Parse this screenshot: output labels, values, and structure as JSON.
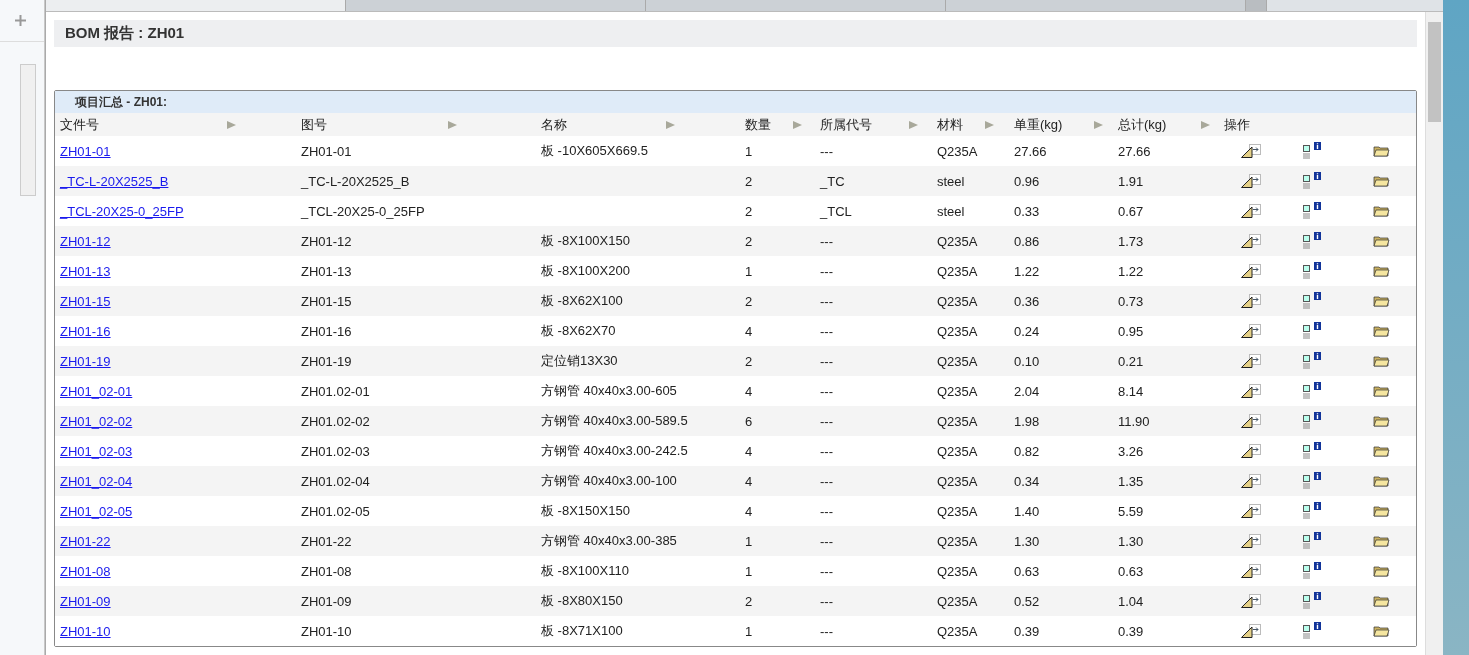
{
  "title": "BOM 报告 : ZH01",
  "section": "项目汇总 - ZH01:",
  "columns": [
    "文件号",
    "图号",
    "名称",
    "数量",
    "所属代号",
    "材料",
    "单重(kg)",
    "总计(kg)",
    "操作"
  ],
  "rows": [
    {
      "file": "ZH01-01",
      "drawing": "ZH01-01",
      "name": "板 -10X605X669.5",
      "qty": "1",
      "code": "---",
      "material": "Q235A",
      "unit": "27.66",
      "total": "27.66"
    },
    {
      "file": "_TC-L-20X2525_B",
      "drawing": "_TC-L-20X2525_B",
      "name": "",
      "qty": "2",
      "code": "_TC",
      "material": "steel",
      "unit": "0.96",
      "total": "1.91"
    },
    {
      "file": "_TCL-20X25-0_25FP",
      "drawing": "_TCL-20X25-0_25FP",
      "name": "",
      "qty": "2",
      "code": "_TCL",
      "material": "steel",
      "unit": "0.33",
      "total": "0.67"
    },
    {
      "file": "ZH01-12",
      "drawing": "ZH01-12",
      "name": "板 -8X100X150",
      "qty": "2",
      "code": "---",
      "material": "Q235A",
      "unit": "0.86",
      "total": "1.73"
    },
    {
      "file": "ZH01-13",
      "drawing": "ZH01-13",
      "name": "板 -8X100X200",
      "qty": "1",
      "code": "---",
      "material": "Q235A",
      "unit": "1.22",
      "total": "1.22"
    },
    {
      "file": "ZH01-15",
      "drawing": "ZH01-15",
      "name": "板 -8X62X100",
      "qty": "2",
      "code": "---",
      "material": "Q235A",
      "unit": "0.36",
      "total": "0.73"
    },
    {
      "file": "ZH01-16",
      "drawing": "ZH01-16",
      "name": "板 -8X62X70",
      "qty": "4",
      "code": "---",
      "material": "Q235A",
      "unit": "0.24",
      "total": "0.95"
    },
    {
      "file": "ZH01-19",
      "drawing": "ZH01-19",
      "name": "定位销13X30",
      "qty": "2",
      "code": "---",
      "material": "Q235A",
      "unit": "0.10",
      "total": "0.21"
    },
    {
      "file": "ZH01_02-01",
      "drawing": "ZH01.02-01",
      "name": "方钢管 40x40x3.00-605",
      "qty": "4",
      "code": "---",
      "material": "Q235A",
      "unit": "2.04",
      "total": "8.14"
    },
    {
      "file": "ZH01_02-02",
      "drawing": "ZH01.02-02",
      "name": "方钢管 40x40x3.00-589.5",
      "qty": "6",
      "code": "---",
      "material": "Q235A",
      "unit": "1.98",
      "total": "11.90"
    },
    {
      "file": "ZH01_02-03",
      "drawing": "ZH01.02-03",
      "name": "方钢管 40x40x3.00-242.5",
      "qty": "4",
      "code": "---",
      "material": "Q235A",
      "unit": "0.82",
      "total": "3.26"
    },
    {
      "file": "ZH01_02-04",
      "drawing": "ZH01.02-04",
      "name": "方钢管 40x40x3.00-100",
      "qty": "4",
      "code": "---",
      "material": "Q235A",
      "unit": "0.34",
      "total": "1.35"
    },
    {
      "file": "ZH01_02-05",
      "drawing": "ZH01.02-05",
      "name": "板 -8X150X150",
      "qty": "4",
      "code": "---",
      "material": "Q235A",
      "unit": "1.40",
      "total": "5.59"
    },
    {
      "file": "ZH01-22",
      "drawing": "ZH01-22",
      "name": "方钢管 40x40x3.00-385",
      "qty": "1",
      "code": "---",
      "material": "Q235A",
      "unit": "1.30",
      "total": "1.30"
    },
    {
      "file": "ZH01-08",
      "drawing": "ZH01-08",
      "name": "板 -8X100X110",
      "qty": "1",
      "code": "---",
      "material": "Q235A",
      "unit": "0.63",
      "total": "0.63"
    },
    {
      "file": "ZH01-09",
      "drawing": "ZH01-09",
      "name": "板 -8X80X150",
      "qty": "2",
      "code": "---",
      "material": "Q235A",
      "unit": "0.52",
      "total": "1.04"
    },
    {
      "file": "ZH01-10",
      "drawing": "ZH01-10",
      "name": "板 -8X71X100",
      "qty": "1",
      "code": "---",
      "material": "Q235A",
      "unit": "0.39",
      "total": "0.39"
    }
  ]
}
